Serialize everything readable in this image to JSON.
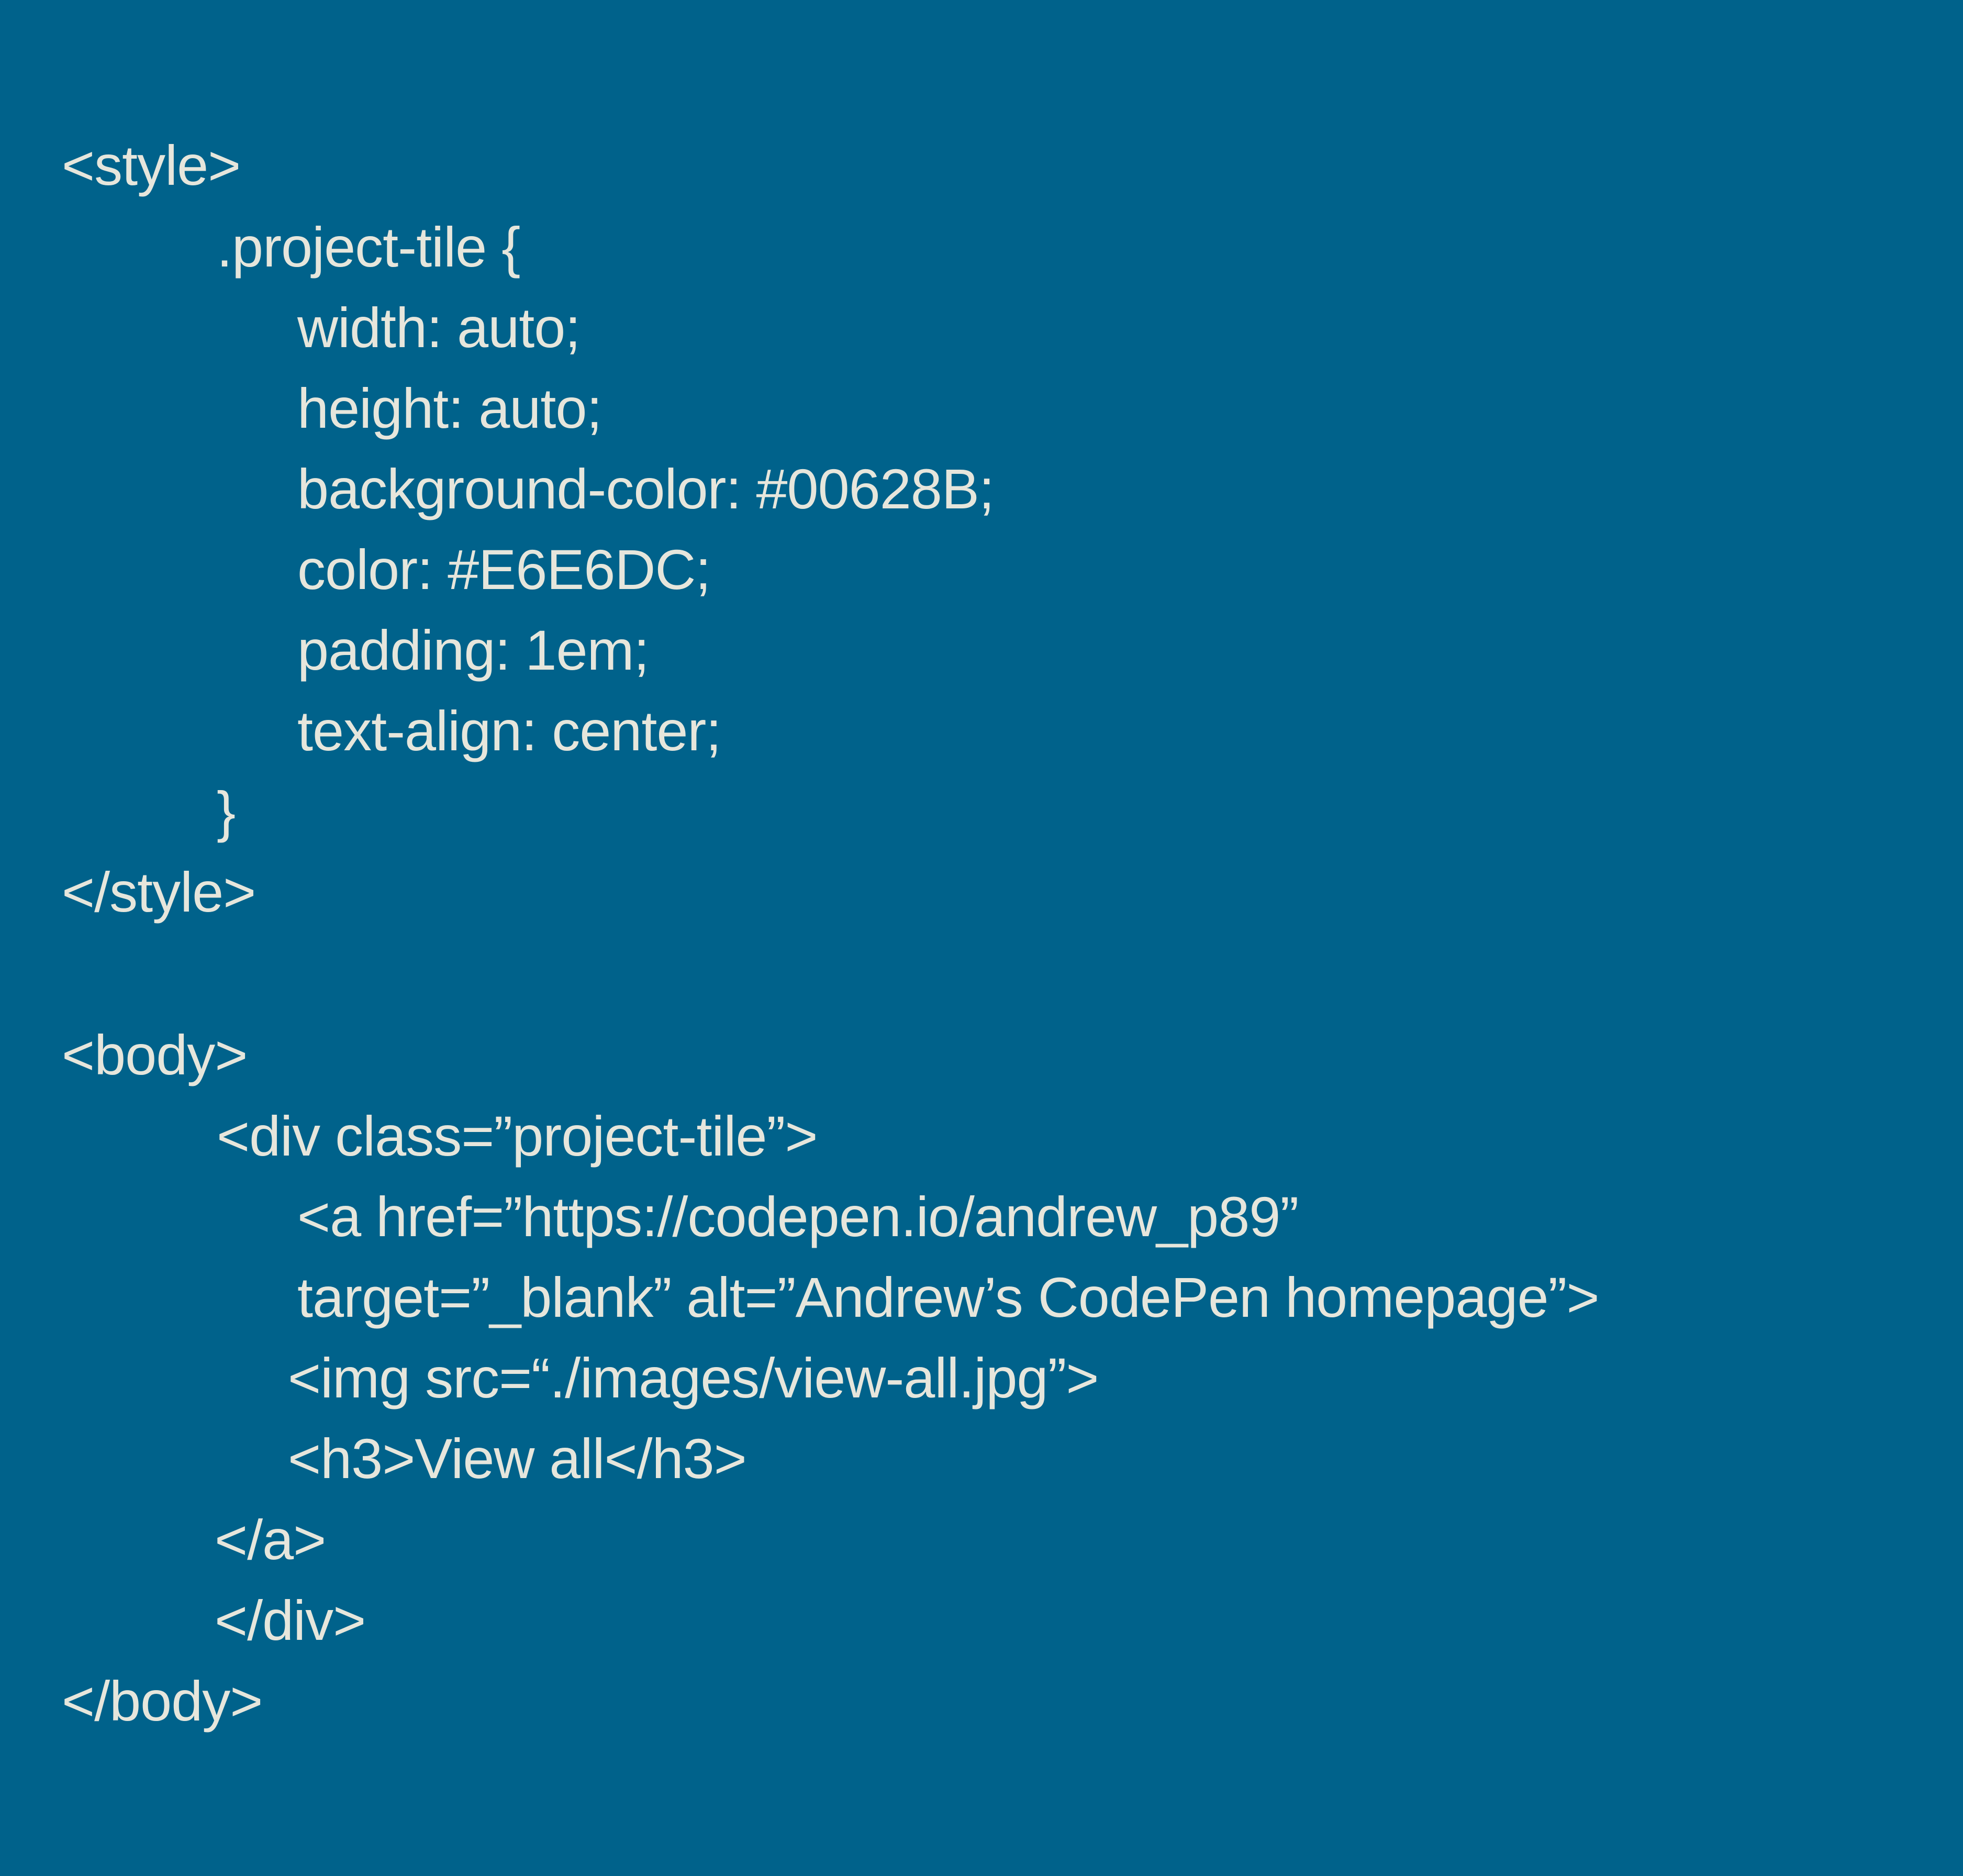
{
  "colors": {
    "background": "#00628B",
    "text": "#E6E6DC"
  },
  "code": {
    "lines": [
      "<style>",
      ".project-tile {",
      "width: auto;",
      "height: auto;",
      "background-color: #00628B;",
      "color: #E6E6DC;",
      "padding: 1em;",
      "text-align: center;",
      "}",
      "</style>",
      "<body>",
      "<div class=”project-tile”>",
      "<a href=”https://codepen.io/andrew_p89”",
      "target=”_blank” alt=”Andrew’s CodePen homepage”>",
      "<img src=“./images/view-all.jpg”>",
      "<h3>View all</h3>",
      "</a>",
      "</div>",
      "</body>"
    ]
  }
}
